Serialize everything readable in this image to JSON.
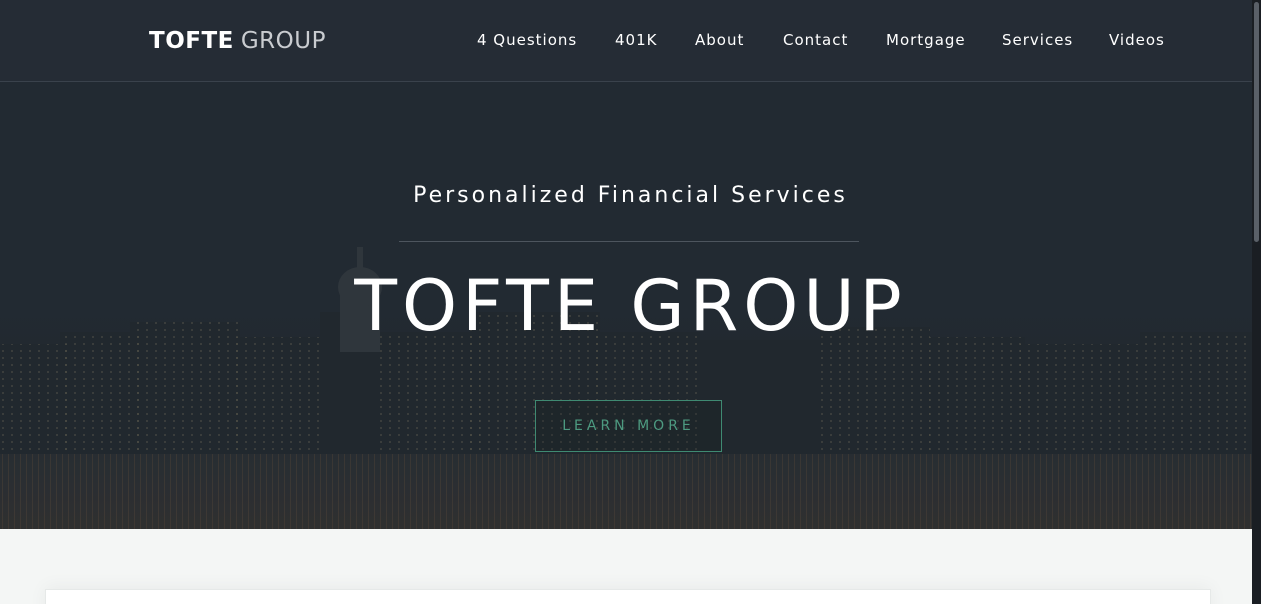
{
  "header": {
    "logo_bold": "TOFTE",
    "logo_light": "GROUP",
    "nav": [
      "4 Questions",
      "401K",
      "About",
      "Contact",
      "Mortgage",
      "Services",
      "Videos"
    ]
  },
  "hero": {
    "tagline": "Personalized Financial Services",
    "title": "TOFTE GROUP",
    "cta_label": "LEARN MORE"
  },
  "colors": {
    "header_bg": "#252c35",
    "accent_green": "#3f8a72",
    "page_bg": "#f4f6f5"
  }
}
